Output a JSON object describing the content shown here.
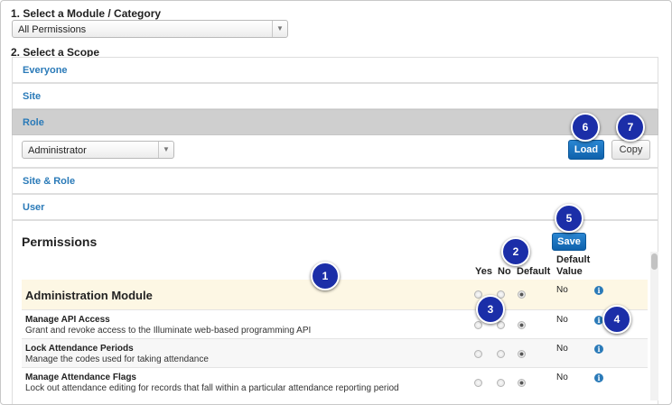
{
  "step1": {
    "label": "1. Select a Module / Category",
    "selected": "All Permissions"
  },
  "step2": {
    "label": "2. Select a Scope"
  },
  "scopes": [
    {
      "label": "Everyone"
    },
    {
      "label": "Site"
    },
    {
      "label": "Role"
    },
    {
      "label": "Site & Role"
    },
    {
      "label": "User"
    }
  ],
  "role_select": {
    "selected": "Administrator"
  },
  "buttons": {
    "load": "Load",
    "copy": "Copy",
    "save": "Save"
  },
  "permissions": {
    "title": "Permissions",
    "columns": {
      "yes": "Yes",
      "no": "No",
      "default": "Default",
      "default_value_1": "Default",
      "default_value_2": "Value"
    },
    "module": {
      "name": "Administration Module",
      "default_value": "No",
      "info": "i"
    },
    "rows": [
      {
        "name": "Manage API Access",
        "desc": "Grant and revoke access to the Illuminate web-based programming API",
        "default_value": "No",
        "info": "i"
      },
      {
        "name": "Lock Attendance Periods",
        "desc": "Manage the codes used for taking attendance",
        "default_value": "No",
        "info": "i"
      },
      {
        "name": "Manage Attendance Flags",
        "desc": "Lock out attendance editing for records that fall within a particular attendance reporting period",
        "default_value": "No",
        "info": "i"
      }
    ]
  },
  "callouts": [
    "1",
    "2",
    "3",
    "4",
    "5",
    "6",
    "7"
  ],
  "colors": {
    "link": "#2a7ab8",
    "button_blue": "#1371c0",
    "badge": "#1b2ea8",
    "module_bg": "#fdf7e4",
    "active_scope": "#cfcfcf"
  }
}
